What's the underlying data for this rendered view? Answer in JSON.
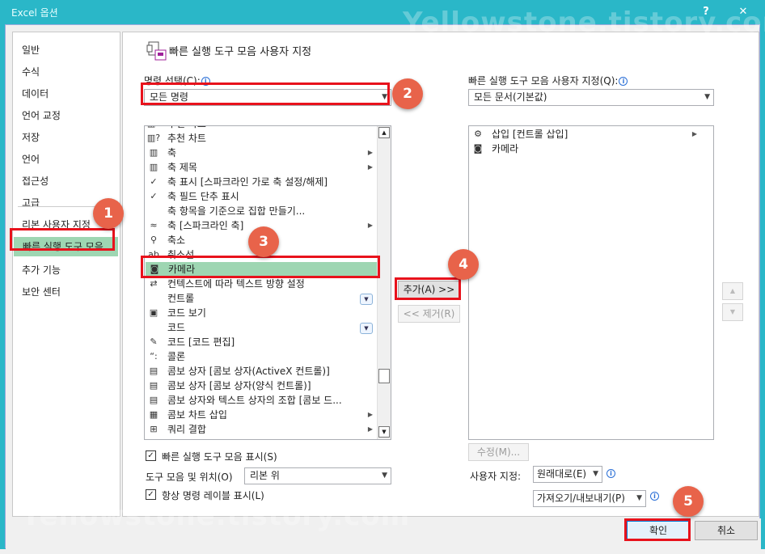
{
  "window": {
    "title": "Excel 옵션",
    "help": "?",
    "close": "✕"
  },
  "watermark": "Yellowstone.tistory.com",
  "nav": {
    "items": [
      "일반",
      "수식",
      "데이터",
      "언어 교정",
      "저장",
      "언어",
      "접근성",
      "고급",
      "리본 사용자 지정",
      "빠른 실행 도구 모음",
      "추가 기능",
      "보안 센터"
    ],
    "selected": "빠른 실행 도구 모음"
  },
  "panel": {
    "heading": "빠른 실행 도구 모음 사용자 지정",
    "choose_label": "명령 선택(C):",
    "choose_value": "모든 명령",
    "customize_label": "빠른 실행 도구 모음 사용자 지정(Q):",
    "customize_value": "모든 문서(기본값)",
    "commands": [
      {
        "label": "추천 자료",
        "icon": "chart-icon"
      },
      {
        "label": "추천 차트",
        "icon": "chart-icon"
      },
      {
        "label": "축",
        "icon": "axis-icon",
        "submenu": true
      },
      {
        "label": "축 제목",
        "icon": "axis-title-icon",
        "submenu": true
      },
      {
        "label": "축 표시 [스파크라인 가로 축 설정/해제]",
        "icon": "check-icon"
      },
      {
        "label": "축 필드 단추 표시",
        "icon": "check-icon"
      },
      {
        "label": "축 항목을 기준으로 집합 만들기...",
        "icon": ""
      },
      {
        "label": "축 [스파크라인 축]",
        "icon": "sparkline-icon",
        "submenu": true
      },
      {
        "label": "축소",
        "icon": "zoom-out-icon"
      },
      {
        "label": "취소선",
        "icon": "strikethrough-icon"
      },
      {
        "label": "카메라",
        "icon": "camera-icon",
        "selected": true
      },
      {
        "label": "컨텍스트에 따라 텍스트 방향 설정",
        "icon": "text-direction-icon"
      },
      {
        "label": "컨트롤",
        "icon": "",
        "dropdown": true
      },
      {
        "label": "코드 보기",
        "icon": "view-code-icon"
      },
      {
        "label": "코드",
        "icon": "",
        "dropdown": true
      },
      {
        "label": "코드 [코드 편집]",
        "icon": "edit-code-icon"
      },
      {
        "label": "콜론",
        "icon": "colon-icon"
      },
      {
        "label": "콤보 상자 [콤보 상자(ActiveX 컨트롤)]",
        "icon": "combo-icon"
      },
      {
        "label": "콤보 상자 [콤보 상자(양식 컨트롤)]",
        "icon": "combo-icon"
      },
      {
        "label": "콤보 상자와 텍스트 상자의 조합 [콤보 드...",
        "icon": "combo-icon"
      },
      {
        "label": "콤보 차트 삽입",
        "icon": "combo-chart-icon",
        "submenu": true
      },
      {
        "label": "쿼리 결합",
        "icon": "query-icon",
        "submenu": true
      }
    ],
    "qat_items": [
      {
        "label": "삽입 [컨트롤 삽입]",
        "icon": "insert-control-icon",
        "submenu": true
      },
      {
        "label": "카메라",
        "icon": "camera-icon"
      }
    ],
    "add_button": "추가(A) >>",
    "remove_button": "<< 제거(R)",
    "modify_button": "수정(M)...",
    "show_qat_label": "빠른 실행 도구 모음 표시(S)",
    "position_label": "도구 모음 및 위치(O)",
    "position_value": "리본 위",
    "always_show_label": "항상 명령 레이블 표시(L)",
    "customize_text": "사용자 지정:",
    "reset_value": "원래대로(E)",
    "import_export_value": "가져오기/내보내기(P)"
  },
  "footer": {
    "ok": "확인",
    "cancel": "취소"
  },
  "callouts": [
    "1",
    "2",
    "3",
    "4",
    "5"
  ]
}
